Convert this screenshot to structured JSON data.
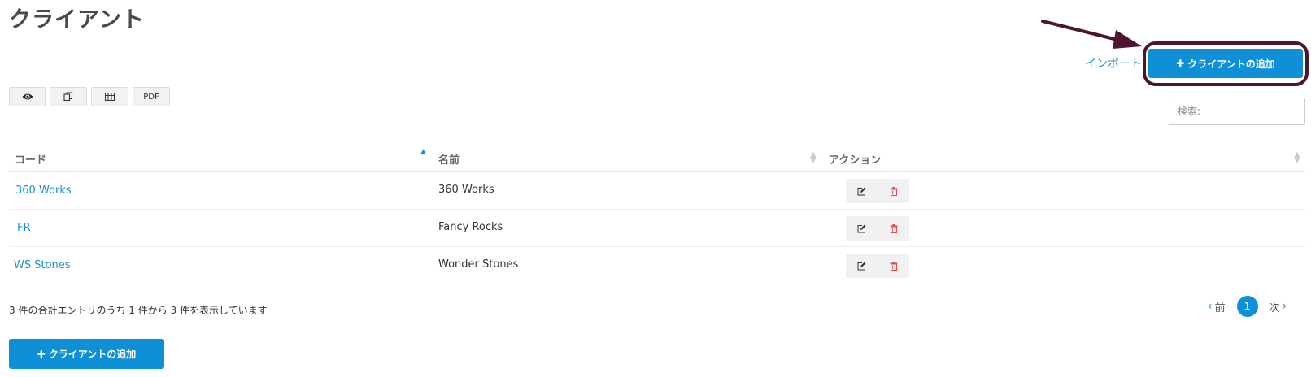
{
  "page": {
    "title": "クライアント"
  },
  "header_actions": {
    "import_label": "インポート",
    "add_client_label": "クライアントの追加",
    "add_icon": "plus-icon"
  },
  "export_toolbar": {
    "buttons": [
      {
        "icon": "eye-icon",
        "label": ""
      },
      {
        "icon": "copy-icon",
        "label": ""
      },
      {
        "icon": "table-icon",
        "label": ""
      },
      {
        "icon": "",
        "label": "PDF"
      }
    ]
  },
  "search": {
    "placeholder": "検索:"
  },
  "table": {
    "columns": [
      {
        "label": "コード",
        "sort": "ascending"
      },
      {
        "label": "名前",
        "sort": "none"
      },
      {
        "label": "アクション",
        "sort": "none"
      }
    ],
    "rows": [
      {
        "code": "360 Works",
        "name": "360 Works"
      },
      {
        "code": "FR",
        "name": "Fancy Rocks"
      },
      {
        "code": "WS Stones",
        "name": "Wonder Stones"
      }
    ],
    "row_action_icons": [
      "edit-icon",
      "trash-icon"
    ]
  },
  "footer": {
    "info": "3 件の合計エントリのうち 1 件から 3 件を表示しています",
    "pagination": {
      "prev": "前",
      "current": "1",
      "next": "次"
    },
    "add_client_label": "クライアントの追加"
  },
  "colors": {
    "accent": "#0e8fd6",
    "link": "#1a8dd1",
    "highlight": "#4d1530",
    "delete": "#e04a4a"
  }
}
